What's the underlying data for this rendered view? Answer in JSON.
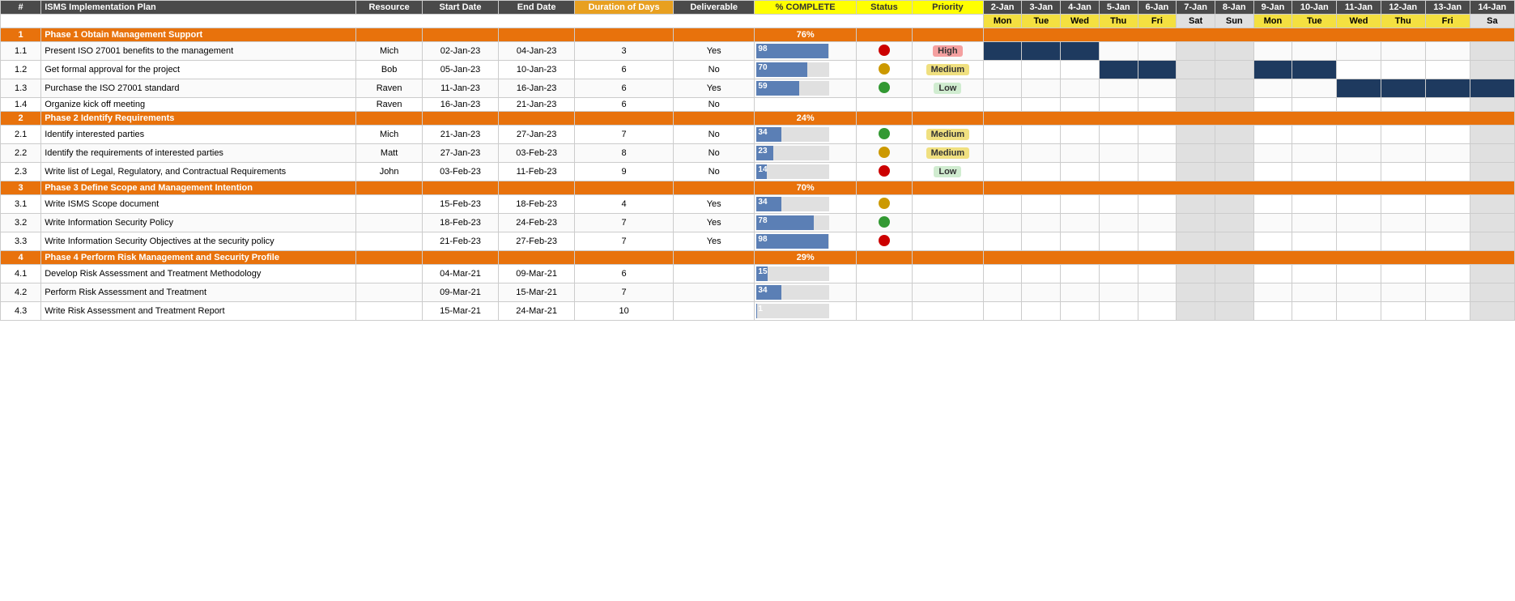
{
  "headers": {
    "num": "#",
    "plan": "ISMS Implementation Plan",
    "resource": "Resource",
    "start": "Start Date",
    "end": "End Date",
    "duration": "Duration of Days",
    "deliverable": "Deliverable",
    "pct": "% COMPLETE",
    "status": "Status",
    "priority": "Priority",
    "days": [
      "2-Jan",
      "3-Jan",
      "4-Jan",
      "5-Jan",
      "6-Jan",
      "7-Jan",
      "8-Jan",
      "9-Jan",
      "10-Jan",
      "11-Jan",
      "12-Jan",
      "13-Jan",
      "14-Jan"
    ],
    "daynames": [
      "Mon",
      "Tue",
      "Wed",
      "Thu",
      "Fri",
      "Sat",
      "Sun",
      "Mon",
      "Tue",
      "Wed",
      "Thu",
      "Fri",
      "Sa"
    ]
  },
  "phases": [
    {
      "num": "1",
      "name": "Phase 1 Obtain Management Support",
      "pct": "76%",
      "tasks": [
        {
          "num": "1.1",
          "name": "Present ISO 27001 benefits to the management",
          "resource": "Mich",
          "start": "02-Jan-23",
          "end": "04-Jan-23",
          "duration": "3",
          "deliverable": "Yes",
          "pct": 98,
          "statusDot": "red",
          "priority": "High",
          "gantt": [
            1,
            1,
            1,
            0,
            0,
            0,
            0,
            0,
            0,
            0,
            0,
            0,
            0
          ]
        },
        {
          "num": "1.2",
          "name": "Get formal approval for the project",
          "resource": "Bob",
          "start": "05-Jan-23",
          "end": "10-Jan-23",
          "duration": "6",
          "deliverable": "No",
          "pct": 70,
          "statusDot": "orange",
          "priority": "Medium",
          "gantt": [
            0,
            0,
            0,
            1,
            1,
            0,
            0,
            1,
            1,
            0,
            0,
            0,
            0
          ]
        },
        {
          "num": "1.3",
          "name": "Purchase the ISO 27001 standard",
          "resource": "Raven",
          "start": "11-Jan-23",
          "end": "16-Jan-23",
          "duration": "6",
          "deliverable": "Yes",
          "pct": 59,
          "statusDot": "green",
          "priority": "Low",
          "gantt": [
            0,
            0,
            0,
            0,
            0,
            0,
            0,
            0,
            0,
            1,
            1,
            1,
            1
          ]
        },
        {
          "num": "1.4",
          "name": "Organize kick off meeting",
          "resource": "Raven",
          "start": "16-Jan-23",
          "end": "21-Jan-23",
          "duration": "6",
          "deliverable": "No",
          "pct": null,
          "statusDot": null,
          "priority": null,
          "gantt": [
            0,
            0,
            0,
            0,
            0,
            0,
            0,
            0,
            0,
            0,
            0,
            0,
            0
          ]
        }
      ]
    },
    {
      "num": "2",
      "name": "Phase 2 Identify Requirements",
      "pct": "24%",
      "tasks": [
        {
          "num": "2.1",
          "name": "Identify interested parties",
          "resource": "Mich",
          "start": "21-Jan-23",
          "end": "27-Jan-23",
          "duration": "7",
          "deliverable": "No",
          "pct": 34,
          "statusDot": "green",
          "priority": "Medium",
          "gantt": [
            0,
            0,
            0,
            0,
            0,
            0,
            0,
            0,
            0,
            0,
            0,
            0,
            0
          ]
        },
        {
          "num": "2.2",
          "name": "Identify the requirements of interested parties",
          "resource": "Matt",
          "start": "27-Jan-23",
          "end": "03-Feb-23",
          "duration": "8",
          "deliverable": "No",
          "pct": 23,
          "statusDot": "orange",
          "priority": "Medium",
          "gantt": [
            0,
            0,
            0,
            0,
            0,
            0,
            0,
            0,
            0,
            0,
            0,
            0,
            0
          ]
        },
        {
          "num": "2.3",
          "name": "Write list of Legal, Regulatory, and Contractual Requirements",
          "resource": "John",
          "start": "03-Feb-23",
          "end": "11-Feb-23",
          "duration": "9",
          "deliverable": "No",
          "pct": 14,
          "statusDot": "red",
          "priority": "Low",
          "gantt": [
            0,
            0,
            0,
            0,
            0,
            0,
            0,
            0,
            0,
            0,
            0,
            0,
            0
          ]
        }
      ]
    },
    {
      "num": "3",
      "name": "Phase 3 Define Scope and Management Intention",
      "pct": "70%",
      "tasks": [
        {
          "num": "3.1",
          "name": "Write ISMS Scope document",
          "resource": "",
          "start": "15-Feb-23",
          "end": "18-Feb-23",
          "duration": "4",
          "deliverable": "Yes",
          "pct": 34,
          "statusDot": "orange",
          "priority": null,
          "gantt": [
            0,
            0,
            0,
            0,
            0,
            0,
            0,
            0,
            0,
            0,
            0,
            0,
            0
          ]
        },
        {
          "num": "3.2",
          "name": "Write Information Security Policy",
          "resource": "",
          "start": "18-Feb-23",
          "end": "24-Feb-23",
          "duration": "7",
          "deliverable": "Yes",
          "pct": 78,
          "statusDot": "green",
          "priority": null,
          "gantt": [
            0,
            0,
            0,
            0,
            0,
            0,
            0,
            0,
            0,
            0,
            0,
            0,
            0
          ]
        },
        {
          "num": "3.3",
          "name": "Write Information Security Objectives at the security policy",
          "resource": "",
          "start": "21-Feb-23",
          "end": "27-Feb-23",
          "duration": "7",
          "deliverable": "Yes",
          "pct": 98,
          "statusDot": "red",
          "priority": null,
          "gantt": [
            0,
            0,
            0,
            0,
            0,
            0,
            0,
            0,
            0,
            0,
            0,
            0,
            0
          ]
        }
      ]
    },
    {
      "num": "4",
      "name": "Phase 4 Perform Risk Management and Security Profile",
      "pct": "29%",
      "tasks": [
        {
          "num": "4.1",
          "name": "Develop Risk Assessment and Treatment Methodology",
          "resource": "",
          "start": "04-Mar-21",
          "end": "09-Mar-21",
          "duration": "6",
          "deliverable": "",
          "pct": 15,
          "statusDot": null,
          "priority": null,
          "gantt": [
            0,
            0,
            0,
            0,
            0,
            0,
            0,
            0,
            0,
            0,
            0,
            0,
            0
          ]
        },
        {
          "num": "4.2",
          "name": "Perform Risk Assessment and Treatment",
          "resource": "",
          "start": "09-Mar-21",
          "end": "15-Mar-21",
          "duration": "7",
          "deliverable": "",
          "pct": 34,
          "statusDot": null,
          "priority": null,
          "gantt": [
            0,
            0,
            0,
            0,
            0,
            0,
            0,
            0,
            0,
            0,
            0,
            0,
            0
          ]
        },
        {
          "num": "4.3",
          "name": "Write Risk Assessment and Treatment Report",
          "resource": "",
          "start": "15-Mar-21",
          "end": "24-Mar-21",
          "duration": "10",
          "deliverable": "",
          "pct": 1,
          "statusDot": null,
          "priority": null,
          "gantt": [
            0,
            0,
            0,
            0,
            0,
            0,
            0,
            0,
            0,
            0,
            0,
            0,
            0
          ]
        }
      ]
    }
  ]
}
